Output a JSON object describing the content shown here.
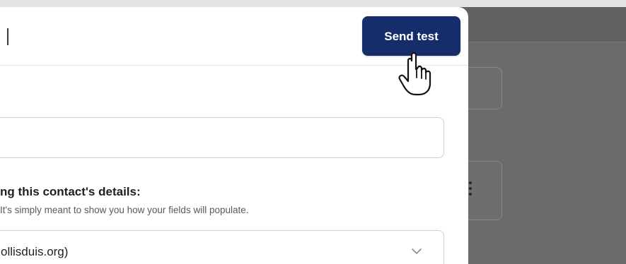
{
  "modal": {
    "send_test_label": "Send test"
  },
  "contact_section": {
    "heading": "ng this contact's details:",
    "help_text": " It's simply meant to show you how your fields will populate.",
    "selected_contact": "ollisduis.org)"
  },
  "icons": {
    "dropdown": "chevron-down-icon",
    "cursor": "hand-pointer-icon",
    "menu": "kebab-menu-icon"
  },
  "colors": {
    "primary": "#152d6b",
    "overlay": "#6b6b6b"
  }
}
